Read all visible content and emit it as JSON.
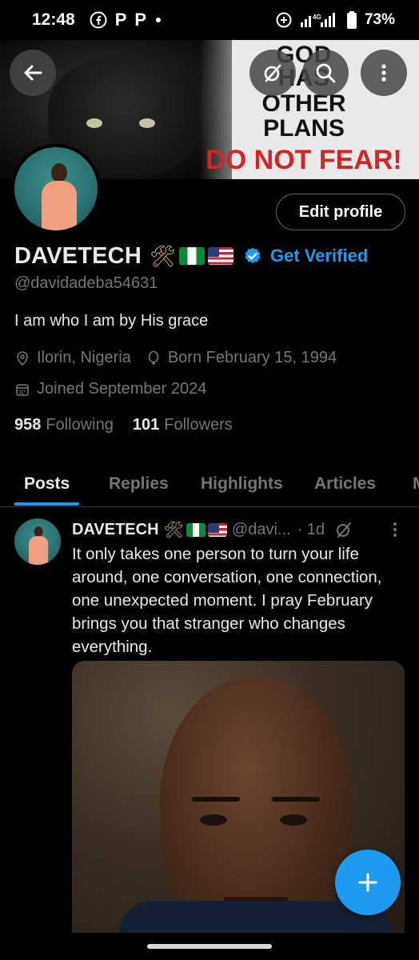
{
  "status_bar": {
    "time": "12:48",
    "app_icons": [
      "facebook-icon",
      "p-icon",
      "p-icon"
    ],
    "p1": "P",
    "p2": "P",
    "network": "4G",
    "battery": "73%"
  },
  "banner": {
    "line1": "GOD",
    "line2": "HAS",
    "line3": "OTHER",
    "line4": "PLANS",
    "line5": "DO NOT FEAR!"
  },
  "header_actions": {
    "back": "back-icon",
    "grok": "grok-icon",
    "search": "search-icon",
    "more": "more-icon"
  },
  "profile": {
    "edit_label": "Edit profile",
    "display_name": "DAVETECH",
    "name_emoji": "🛠",
    "get_verified": "Get Verified",
    "handle": "@davidadeba54631",
    "bio": "I am who I am by His grace",
    "location": "Ilorin, Nigeria",
    "born": "Born February 15, 1994",
    "joined": "Joined September 2024",
    "following_count": "958",
    "following_label": "Following",
    "followers_count": "101",
    "followers_label": "Followers"
  },
  "tabs": [
    {
      "label": "Posts",
      "active": true
    },
    {
      "label": "Replies",
      "active": false
    },
    {
      "label": "Highlights",
      "active": false
    },
    {
      "label": "Articles",
      "active": false
    },
    {
      "label": "M",
      "active": false
    }
  ],
  "post": {
    "author": "DAVETECH",
    "emoji": "🛠",
    "handle": "@davi...",
    "time": "· 1d",
    "text": "It only takes one person to turn your life around, one conversation, one connection, one unexpected moment. I pray February brings you that stranger who changes everything."
  },
  "colors": {
    "accent": "#1d9bf0",
    "background": "#000000",
    "text_primary": "#e7e9ea",
    "text_secondary": "#71767b",
    "banner_red": "#d22525"
  }
}
